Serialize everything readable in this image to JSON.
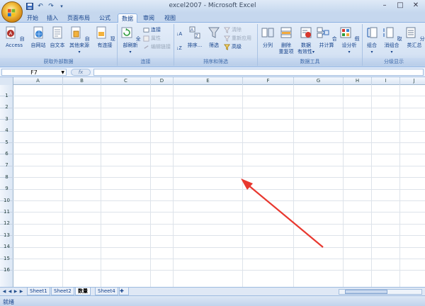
{
  "window": {
    "title": "excel2007 - Microsoft Excel",
    "minimize_icon": "minimize-icon",
    "maximize_icon": "maximize-icon",
    "close_icon": "close-icon"
  },
  "quick_access": [
    "save-icon",
    "undo-icon",
    "redo-icon",
    "customize-icon"
  ],
  "tabs": [
    {
      "label": "开始",
      "active": false
    },
    {
      "label": "插入",
      "active": false
    },
    {
      "label": "页面布局",
      "active": false
    },
    {
      "label": "公式",
      "active": false
    },
    {
      "label": "数据",
      "active": true
    },
    {
      "label": "审阅",
      "active": false
    },
    {
      "label": "视图",
      "active": false
    }
  ],
  "ribbon": {
    "get_external": {
      "label": "获取外部数据",
      "access": "自 Access",
      "web": "自网站",
      "text": "自文本",
      "other": "自其他来源",
      "existing": "现有连接"
    },
    "connections": {
      "label": "连接",
      "refresh_all": "全部刷新",
      "connections": "连接",
      "properties": "属性",
      "edit_links": "编辑链接"
    },
    "sort_filter": {
      "label": "排序和筛选",
      "sort": "排序...",
      "filter": "筛选",
      "clear": "清除",
      "reapply": "重新应用",
      "advanced": "高级"
    },
    "data_tools": {
      "label": "数据工具",
      "text_to_columns": "分列",
      "remove_dup_line1": "删除",
      "remove_dup_line2": "重复项",
      "validation_line1": "数据",
      "validation_line2": "有效性",
      "consolidate": "合并计算",
      "what_if": "假设分析"
    },
    "outline": {
      "label": "分级显示",
      "group": "组合",
      "ungroup": "取消组合",
      "subtotal": "分类汇总"
    }
  },
  "formula_bar": {
    "name_box": "F7",
    "fx": "fx",
    "formula": ""
  },
  "columns": [
    "A",
    "B",
    "C",
    "D",
    "E",
    "F",
    "G",
    "H",
    "I",
    "J"
  ],
  "rows": [
    "1",
    "2",
    "3",
    "4",
    "5",
    "6",
    "7",
    "8",
    "9",
    "10",
    "11",
    "12",
    "13",
    "14",
    "15",
    "16"
  ],
  "sheets": [
    {
      "name": "Sheet1",
      "active": false
    },
    {
      "name": "Sheet2",
      "active": false
    },
    {
      "name": "数量",
      "active": true
    },
    {
      "name": "Sheet4",
      "active": false
    }
  ],
  "status": "就绪",
  "colors": {
    "accent": "#e8382f",
    "ribbon": "#d6e3f4"
  }
}
